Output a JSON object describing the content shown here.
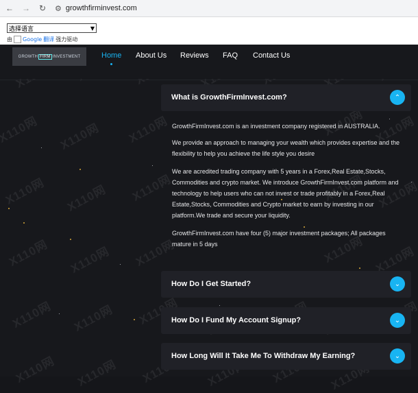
{
  "browser": {
    "url": "growthfirminvest.com"
  },
  "translate": {
    "select_label": "选择语言",
    "powered_prefix": "由",
    "google_logo_alt": "Google",
    "translate_link": "翻译",
    "powered_suffix": "强力驱动"
  },
  "site": {
    "logo": {
      "part1": "GROWTH",
      "part2": "FIRM",
      "part3": "INVESTMENT"
    },
    "nav": [
      {
        "label": "Home",
        "active": true
      },
      {
        "label": "About Us",
        "active": false
      },
      {
        "label": "Reviews",
        "active": false
      },
      {
        "label": "FAQ",
        "active": false
      },
      {
        "label": "Contact Us",
        "active": false
      }
    ],
    "accent_color": "#18b4f2",
    "watermark_text": "X110网"
  },
  "faq": [
    {
      "question": "What is GrowthFirmInvest.com?",
      "expanded": true,
      "answer": [
        "GrowthFirmInvest.com is an investment company registered in AUSTRALIA.",
        "We provide an approach to managing your wealth which provides expertise and the flexibility to help you achieve the life style you desire",
        "We are acredited trading company with 5 years in a Forex,Real Estate,Stocks, Commodities and crypto market. We introduce GrowthFirmInvest.com platform and technology to help users who can not invest or trade profitably in a Forex,Real Estate,Stocks, Commodities and Crypto market to earn by investing in our platform.We trade and secure your liquidity.",
        "GrowthFirmInvest.com have four (5) major investment packages; All packages mature in 5 days"
      ]
    },
    {
      "question": "How Do I Get Started?",
      "expanded": false
    },
    {
      "question": "How Do I Fund My Account Signup?",
      "expanded": false
    },
    {
      "question": "How Long Will It Take Me To Withdraw My Earning?",
      "expanded": false
    }
  ]
}
